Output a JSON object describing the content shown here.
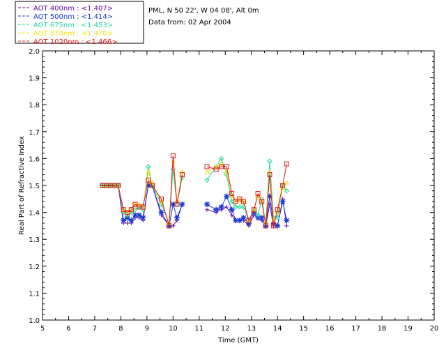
{
  "header": {
    "site_line": "PML, N 50 22', W 04 08', Alt 0m",
    "date_line": "Data from: 02 Apr 2004"
  },
  "chart_data": {
    "type": "line",
    "xlabel": "Time (GMT)",
    "ylabel": "Real Part of Refractive Index",
    "xlim": [
      5,
      20
    ],
    "ylim": [
      1.0,
      2.0
    ],
    "xticks": [
      5,
      6,
      7,
      8,
      9,
      10,
      11,
      12,
      13,
      14,
      15,
      16,
      17,
      18,
      19,
      20
    ],
    "yticks": [
      1.0,
      1.1,
      1.2,
      1.3,
      1.4,
      1.5,
      1.6,
      1.7,
      1.8,
      1.9,
      2.0
    ],
    "grid": false,
    "legend_position": "top-left",
    "series": [
      {
        "name": "AOT 400nm : <1.407>",
        "color": "#6a0ea8",
        "marker": "plus",
        "x": [
          7.3,
          7.45,
          7.6,
          7.75,
          7.9,
          8.1,
          8.25,
          8.4,
          8.55,
          8.7,
          8.85,
          9.05,
          9.2,
          9.55,
          9.85,
          10.0,
          10.15,
          10.35,
          11.3,
          11.65,
          11.85,
          12.05,
          12.25,
          12.4,
          12.55,
          12.7,
          12.9,
          13.1,
          13.25,
          13.4,
          13.55,
          13.7,
          13.85,
          14.0,
          14.2,
          14.35
        ],
        "y": [
          1.5,
          1.5,
          1.5,
          1.5,
          1.5,
          1.36,
          1.36,
          1.36,
          1.38,
          1.38,
          1.37,
          1.5,
          1.5,
          1.39,
          1.35,
          1.35,
          1.37,
          1.43,
          1.41,
          1.4,
          1.41,
          1.42,
          1.39,
          1.37,
          1.37,
          1.37,
          1.35,
          1.39,
          1.38,
          1.37,
          1.35,
          1.43,
          1.35,
          1.35,
          1.45,
          1.35
        ]
      },
      {
        "name": "AOT 500nm : <1.414>",
        "color": "#1a3cd8",
        "marker": "asterisk",
        "x": [
          7.3,
          7.45,
          7.6,
          7.75,
          7.9,
          8.1,
          8.25,
          8.4,
          8.55,
          8.7,
          8.85,
          9.05,
          9.2,
          9.55,
          9.85,
          10.0,
          10.15,
          10.35,
          11.3,
          11.65,
          11.85,
          12.05,
          12.25,
          12.4,
          12.55,
          12.7,
          12.9,
          13.1,
          13.25,
          13.4,
          13.55,
          13.7,
          13.85,
          14.0,
          14.2,
          14.35
        ],
        "y": [
          1.5,
          1.5,
          1.5,
          1.5,
          1.5,
          1.37,
          1.38,
          1.37,
          1.39,
          1.39,
          1.38,
          1.5,
          1.5,
          1.4,
          1.35,
          1.43,
          1.38,
          1.43,
          1.43,
          1.41,
          1.42,
          1.46,
          1.41,
          1.37,
          1.37,
          1.38,
          1.36,
          1.4,
          1.38,
          1.38,
          1.35,
          1.46,
          1.36,
          1.35,
          1.44,
          1.37
        ]
      },
      {
        "name": "AOT 675nm : <1.453>",
        "color": "#22d6a0",
        "marker": "diamond",
        "x": [
          7.3,
          7.45,
          7.6,
          7.75,
          7.9,
          8.1,
          8.25,
          8.4,
          8.55,
          8.7,
          8.85,
          9.05,
          9.2,
          9.55,
          9.85,
          10.0,
          10.15,
          10.35,
          11.3,
          11.65,
          11.85,
          12.05,
          12.25,
          12.4,
          12.55,
          12.7,
          12.9,
          13.1,
          13.25,
          13.4,
          13.55,
          13.7,
          13.85,
          14.0,
          14.2,
          14.35
        ],
        "y": [
          1.5,
          1.5,
          1.5,
          1.5,
          1.5,
          1.4,
          1.39,
          1.4,
          1.41,
          1.42,
          1.41,
          1.57,
          1.5,
          1.43,
          1.36,
          1.56,
          1.43,
          1.53,
          1.52,
          1.57,
          1.6,
          1.54,
          1.44,
          1.42,
          1.42,
          1.42,
          1.37,
          1.41,
          1.39,
          1.45,
          1.36,
          1.59,
          1.38,
          1.38,
          1.5,
          1.48
        ]
      },
      {
        "name": "AOT 870nm : <1.470>",
        "color": "#f5e21a",
        "marker": "triangle",
        "x": [
          7.3,
          7.45,
          7.6,
          7.75,
          7.9,
          8.1,
          8.25,
          8.4,
          8.55,
          8.7,
          8.85,
          9.05,
          9.2,
          9.55,
          9.85,
          10.0,
          10.15,
          10.35,
          11.3,
          11.65,
          11.85,
          12.05,
          12.25,
          12.4,
          12.55,
          12.7,
          12.9,
          13.1,
          13.25,
          13.4,
          13.55,
          13.7,
          13.85,
          14.0,
          14.2,
          14.35
        ],
        "y": [
          1.5,
          1.5,
          1.5,
          1.5,
          1.5,
          1.41,
          1.4,
          1.41,
          1.43,
          1.43,
          1.42,
          1.55,
          1.51,
          1.44,
          1.36,
          1.59,
          1.44,
          1.55,
          1.55,
          1.57,
          1.58,
          1.55,
          1.46,
          1.44,
          1.45,
          1.44,
          1.37,
          1.41,
          1.46,
          1.44,
          1.36,
          1.55,
          1.37,
          1.4,
          1.49,
          1.51
        ]
      },
      {
        "name": "AOT 1020nm : <1.466>",
        "color": "#e01818",
        "marker": "square",
        "x": [
          7.3,
          7.45,
          7.6,
          7.75,
          7.9,
          8.1,
          8.25,
          8.4,
          8.55,
          8.7,
          8.85,
          9.05,
          9.2,
          9.55,
          9.85,
          10.0,
          10.15,
          10.35,
          11.3,
          11.65,
          11.85,
          12.05,
          12.25,
          12.4,
          12.55,
          12.7,
          12.9,
          13.1,
          13.25,
          13.4,
          13.55,
          13.7,
          13.85,
          14.0,
          14.2,
          14.35
        ],
        "y": [
          1.5,
          1.5,
          1.5,
          1.5,
          1.5,
          1.41,
          1.4,
          1.41,
          1.43,
          1.42,
          1.42,
          1.52,
          1.5,
          1.45,
          1.35,
          1.61,
          1.43,
          1.54,
          1.57,
          1.56,
          1.57,
          1.57,
          1.47,
          1.44,
          1.45,
          1.44,
          1.37,
          1.41,
          1.47,
          1.44,
          1.35,
          1.54,
          1.35,
          1.41,
          1.5,
          1.58
        ]
      }
    ]
  }
}
